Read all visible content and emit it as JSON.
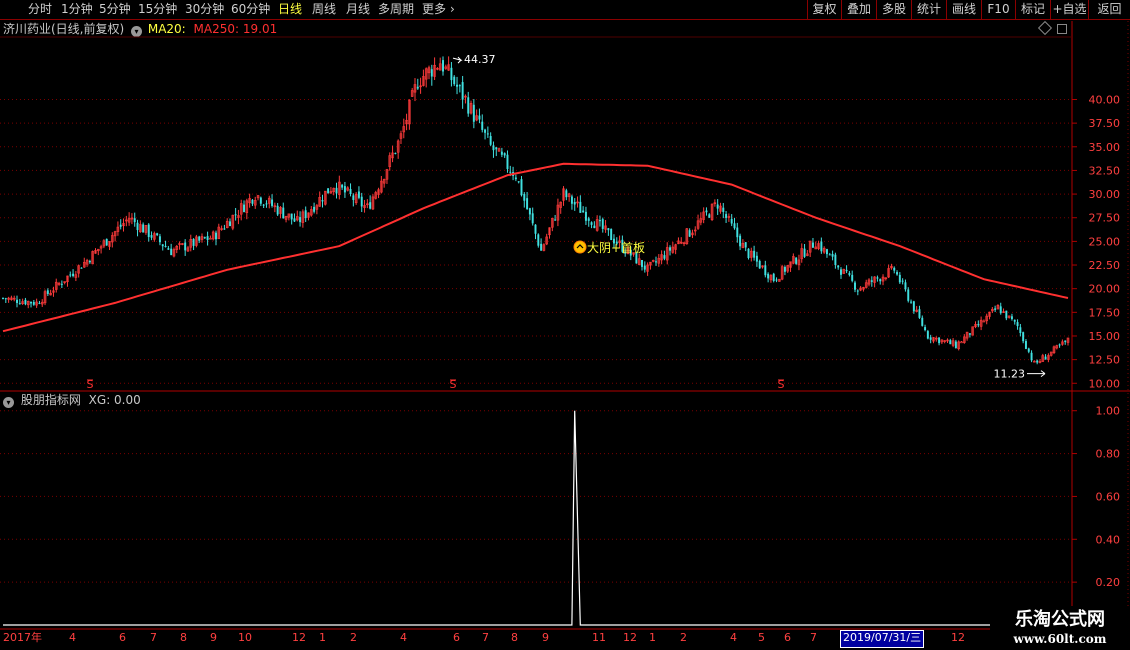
{
  "toolbar": {
    "left_items": [
      "分时",
      "1分钟",
      "5分钟",
      "15分钟",
      "30分钟",
      "60分钟",
      "日线",
      "周线",
      "月线",
      "多周期",
      "更多"
    ],
    "active_item": "日线",
    "more_arrow": "›",
    "right_items": [
      "复权",
      "叠加",
      "多股",
      "统计",
      "画线",
      "F10",
      "标记",
      "+自选",
      "返回"
    ]
  },
  "main_info": {
    "stock": "济川药业(日线,前复权)",
    "ma20_label": "MA20:",
    "ma250_label": "MA250: 19.01",
    "colors": {
      "stock": "#c8c8c8",
      "ma20": "#ffff40",
      "ma250": "#ff3030",
      "up": "#ff3b3b",
      "down": "#40e0e0"
    }
  },
  "sub_info": {
    "title": "股朋指标网",
    "value": "XG: 0.00"
  },
  "annotations": {
    "high": "44.37",
    "low": "11.23",
    "signal": "大阴+首板",
    "dividend_mark": "S"
  },
  "chart_data": [
    {
      "type": "candlestick",
      "title": "",
      "ylim": [
        9.5,
        46.5
      ],
      "y_ticks": [
        "40.00",
        "37.50",
        "35.00",
        "32.50",
        "30.00",
        "27.50",
        "25.00",
        "22.50",
        "20.00",
        "17.50",
        "15.00",
        "12.50",
        "10.00"
      ],
      "close_trend": {
        "x": [
          0,
          12,
          30,
          45,
          60,
          75,
          90,
          105,
          118,
          130,
          142,
          148,
          156,
          165,
          174,
          183,
          192,
          200,
          215,
          230,
          245,
          255,
          265,
          275,
          290,
          305,
          318,
          330,
          340,
          355,
          362,
          368,
          380
        ],
        "y": [
          19,
          18.5,
          23,
          27.5,
          24,
          25.5,
          30,
          27,
          31,
          28.5,
          36,
          42,
          44,
          40,
          35,
          32,
          24,
          30,
          26,
          22,
          26,
          29,
          24,
          21,
          25,
          20,
          22,
          15,
          14,
          18,
          16,
          12,
          14.5
        ]
      },
      "series": [
        {
          "name": "MA250",
          "x": [
            0,
            40,
            80,
            120,
            150,
            180,
            200,
            230,
            260,
            290,
            320,
            350,
            380
          ],
          "y": [
            15.5,
            18.5,
            22,
            24.5,
            28.5,
            32,
            33.2,
            33,
            31,
            27.5,
            24.5,
            21,
            19.01
          ]
        }
      ]
    },
    {
      "type": "line",
      "title": "",
      "ylim": [
        0,
        1.05
      ],
      "y_ticks": [
        "1.00",
        "0.80",
        "0.60",
        "0.40",
        "0.20"
      ],
      "series": [
        {
          "name": "XG",
          "x": [
            0,
            203,
            204,
            205,
            206,
            380
          ],
          "y": [
            0,
            0,
            1,
            0.5,
            0,
            0
          ]
        }
      ]
    }
  ],
  "dates": [
    "2017年",
    "4",
    "6",
    "7",
    "8",
    "9",
    "10",
    "12",
    "1",
    "2",
    "4",
    "6",
    "7",
    "8",
    "9",
    "11",
    "12",
    "1",
    "2",
    "4",
    "5",
    "6",
    "7",
    "2019/07/31/三",
    "12"
  ],
  "logo": {
    "line1": "乐淘公式网",
    "line2": "www.60lt.com"
  }
}
